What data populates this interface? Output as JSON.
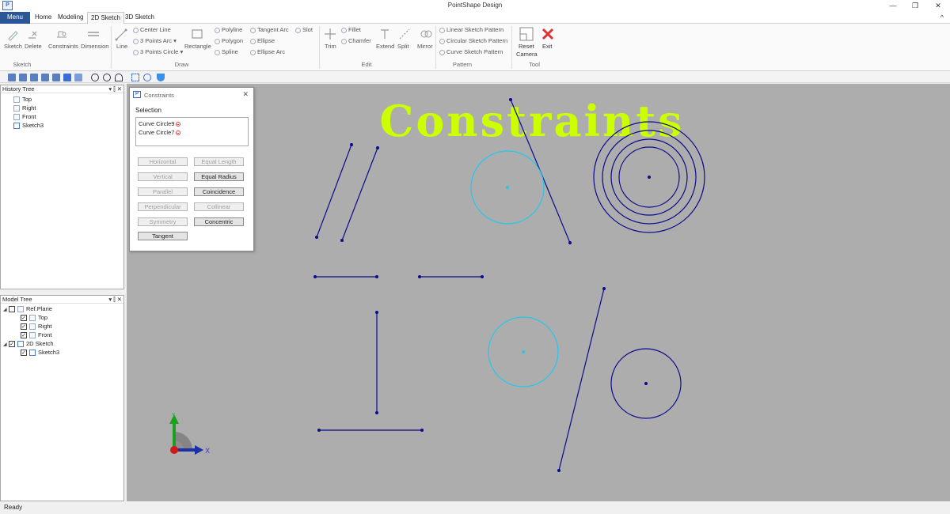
{
  "app": {
    "logo": "P",
    "title": "PointShape Design",
    "controls": {
      "minimize": "—",
      "restore": "❐",
      "close": "✕"
    },
    "collapse": "^"
  },
  "tabs": [
    {
      "label": "Menu"
    },
    {
      "label": "Home"
    },
    {
      "label": "Modeling"
    },
    {
      "label": "2D Sketch"
    },
    {
      "label": "3D Sketch"
    }
  ],
  "ribbon": {
    "groups": {
      "sketch": "Sketch",
      "draw": "Draw",
      "edit": "Edit",
      "pattern": "Pattern",
      "tool": "Tool"
    },
    "sketch": {
      "sketch": "Sketch",
      "delete": "Delete",
      "constraints": "Constraints",
      "dimension": "Dimension"
    },
    "draw": {
      "line": "Line",
      "center_line": "Center Line",
      "three_points_arc": "3 Points Arc",
      "three_points_circle": "3 Points Circle",
      "rectangle": "Rectangle",
      "polyline": "Polyline",
      "polygon": "Polygon",
      "spline": "Spline",
      "tangent_arc": "Tangent Arc",
      "ellipse": "Ellipse",
      "ellipse_arc": "Ellipse Arc",
      "slot": "Slot"
    },
    "edit": {
      "trim": "Trim",
      "fillet": "Fillet",
      "chamfer": "Chamfer",
      "extend": "Extend",
      "split": "Split",
      "mirror": "Mirror"
    },
    "pattern": {
      "linear": "Linear Sketch Pattern",
      "circular": "Circular Sketch Pattern",
      "curve": "Curve Sketch Pattern"
    },
    "tool": {
      "reset_camera_1": "Reset",
      "reset_camera_2": "Camera",
      "exit": "Exit"
    }
  },
  "history_tree": {
    "title": "History Tree",
    "controls": "▾ ⫿ ✕",
    "items": [
      "Top",
      "Right",
      "Front",
      "Sketch3"
    ]
  },
  "model_tree": {
    "title": "Model Tree",
    "controls": "▾ ⫿ ✕",
    "ref_plane": "Ref.Plane",
    "planes": [
      "Top",
      "Right",
      "Front"
    ],
    "sketch_2d": "2D Sketch",
    "sketch": "Sketch3"
  },
  "dialog": {
    "logo": "P",
    "title": "Constraints",
    "close": "✕",
    "selection_label": "Selection",
    "selection_items": [
      "Curve Circle9",
      "Curve Circle7"
    ],
    "buttons": {
      "horizontal": "Horizontal",
      "equal_length": "Equal Length",
      "vertical": "Vertical",
      "equal_radius": "Equal Radius",
      "parallel": "Parallel",
      "coincidence": "Coincidence",
      "perpendicular": "Perpendicular",
      "collinear": "Collinear",
      "symmetry": "Symmetry",
      "concentric": "Concentric",
      "tangent": "Tangent"
    }
  },
  "viewport": {
    "overlay_title": "Constraints",
    "overlay_color": "#ccff00",
    "line_color": "#0a0a8c",
    "selected_color": "#22c8ee",
    "axis_x_label": "X",
    "axis_y_label": "Y"
  },
  "status": {
    "text": "Ready"
  }
}
